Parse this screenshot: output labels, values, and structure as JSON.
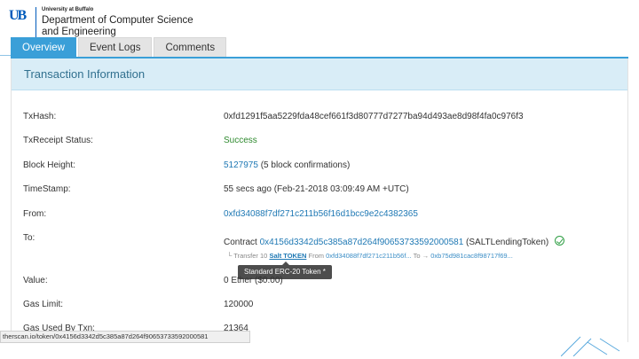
{
  "header": {
    "logo_text": "UB",
    "university": "University at Buffalo",
    "department_line1": "Department of Computer Science",
    "department_line2": "and Engineering"
  },
  "tabs": [
    {
      "label": "Overview",
      "active": true
    },
    {
      "label": "Event Logs",
      "active": false
    },
    {
      "label": "Comments",
      "active": false
    }
  ],
  "panel": {
    "title": "Transaction Information"
  },
  "rows": {
    "txhash": {
      "label": "TxHash:",
      "value": "0xfd1291f5aa5229fda48cef661f3d80777d7277ba94d493ae8d98f4fa0c976f3"
    },
    "status": {
      "label": "TxReceipt Status:",
      "value": "Success"
    },
    "block": {
      "label": "Block Height:",
      "value_link": "5127975",
      "value_suffix": "(5 block confirmations)"
    },
    "timestamp": {
      "label": "TimeStamp:",
      "value": "55 secs ago (Feb-21-2018 03:09:49 AM +UTC)"
    },
    "from": {
      "label": "From:",
      "value": "0xfd34088f7df271c211b56f16d1bcc9e2c4382365"
    },
    "to": {
      "label": "To:",
      "prefix": "Contract",
      "contract": "0x4156d3342d5c385a87d264f90653733592000581",
      "contract_name": "(SALTLendingToken)"
    },
    "transfer": {
      "prefix": "└ Transfer 10",
      "token": "Salt TOKEN",
      "from_label": "From",
      "from_addr": "0xfd34088f7df271c211b56f...",
      "to_label": "To →",
      "to_addr": "0xb75d981cac8f98717f69..."
    },
    "tooltip": "Standard ERC-20 Token *",
    "value": {
      "label": "Value:",
      "value": "0 Ether ($0.00)"
    },
    "gas_limit": {
      "label": "Gas Limit:",
      "value": "120000"
    },
    "gas_used": {
      "label": "Gas Used By Txn:",
      "value": "21364"
    }
  },
  "status_bar": {
    "url": "therscan.io/token/0x4156d3342d5c385a87d264f90653733592000581"
  },
  "colors": {
    "accent": "#3a9fd8",
    "panel_header": "#d9edf7",
    "link": "#1e78b4",
    "success": "#2f8a2f",
    "ub_blue": "#005bbb"
  }
}
